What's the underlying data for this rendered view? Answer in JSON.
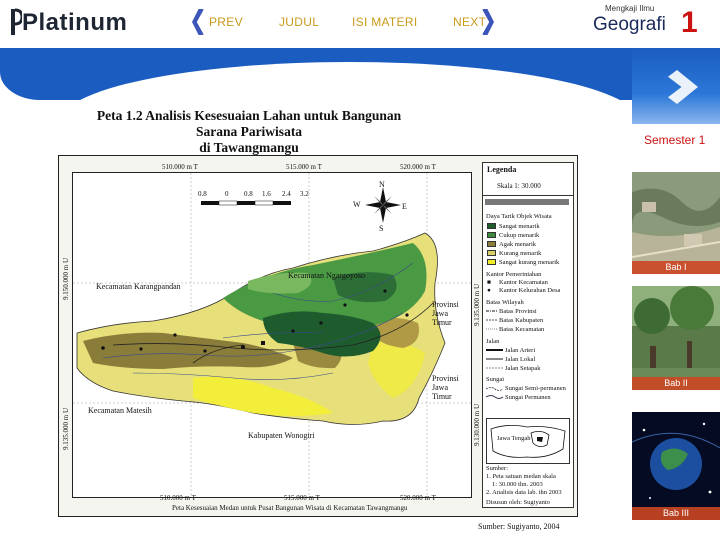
{
  "header": {
    "logo_text": "Platinum",
    "nav": {
      "prev": "PREV",
      "judul": "JUDUL",
      "isi": "ISI MATERI",
      "next": "NEXT"
    },
    "tagline": "Mengkaji Ilmu",
    "subject": "Geografi",
    "grade": "1"
  },
  "sidebar": {
    "semester": "Semester 1",
    "chapters": [
      {
        "label": "Bab I"
      },
      {
        "label": "Bab II"
      },
      {
        "label": "Bab III"
      }
    ]
  },
  "figure": {
    "title_line1": "Peta 1.2 Analisis Kesesuaian Lahan untuk Bangunan Sarana Pariwisata",
    "title_line2": "di Tawangmangu",
    "coords_top": [
      "510.000 m T",
      "515.000 m T",
      "520.000 m T"
    ],
    "coords_bottom": [
      "510.000 m T",
      "515.000 m T",
      "520.000 m T"
    ],
    "coords_left": [
      "9.150.000 m U",
      "9.135.000 m U"
    ],
    "coords_right": [
      "9.135.000 m U",
      "9.130.000 m U"
    ],
    "scale_ticks": [
      "0.8",
      "0",
      "0.8",
      "1.6",
      "2.4",
      "3.2"
    ],
    "compass": {
      "n": "N",
      "s": "S",
      "w": "W",
      "e": "E"
    },
    "places": {
      "karangpandan": "Kecamatan Karangpandan",
      "ngargoyoso": "Kecamatan Ngargoyoso",
      "prov1_l1": "Provinsi",
      "prov1_l2": "Jawa",
      "prov1_l3": "Timur",
      "prov2_l1": "Provinsi",
      "prov2_l2": "Jawa",
      "prov2_l3": "Timur",
      "matesih": "Kecamatan Matesih",
      "wonogiri": "Kabupaten Wonogiri"
    },
    "bottom_caption": "Peta Kesesuaian Medan untuk Pusat Bangunan Wisata di Kecamatan Tawangmangu",
    "source": "Sumber: Sugiyanto, 2004"
  },
  "legend": {
    "title": "Legenda",
    "scale": "Skala 1: 30.000",
    "class_title": "Daya Tarik Objek Wisata",
    "classes": [
      {
        "label": "Sangat menarik",
        "color": "#1e5c2e"
      },
      {
        "label": "Cukup menarik",
        "color": "#3f8a3a"
      },
      {
        "label": "Agak menarik",
        "color": "#8a7d3a"
      },
      {
        "label": "Kurang menarik",
        "color": "#d8d26a"
      },
      {
        "label": "Sangat kurang menarik",
        "color": "#f0ec2a"
      }
    ],
    "office_title": "Kantor Pemerintahan",
    "offices": [
      "Kantor Kecamatan",
      "Kantor Kelurahan Desa"
    ],
    "boundary_title": "Batas Wilayah",
    "boundaries": [
      "Batas Provinsi",
      "Batas Kabupaten",
      "Batas Kecamatan"
    ],
    "road_title": "Jalan",
    "roads": [
      "Jalan Arteri",
      "Jalan Lokal",
      "Jalan Setapak"
    ],
    "river_title": "Sungai",
    "rivers": [
      "Sungai Semi-permanen",
      "Sungai Permanen"
    ],
    "inset_label": "Jawa Tengah",
    "sources_title": "Sumber:",
    "sources": [
      "1. Peta satuan medan skala",
      "1: 30.000 thn. 2003",
      "2. Analisis data lab. thn 2003"
    ],
    "author": "Disusun oleh: Sugiyanto"
  }
}
